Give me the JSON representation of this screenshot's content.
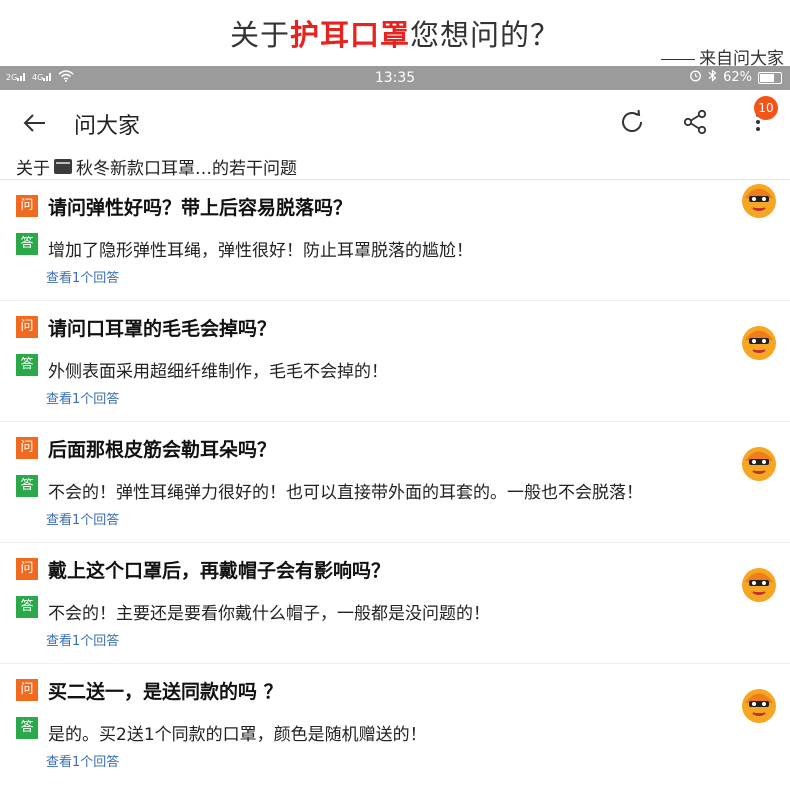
{
  "promo": {
    "title_before": "关于",
    "title_highlight": "护耳口罩",
    "title_after": "您想问的？",
    "source": "来自问大家"
  },
  "statusbar": {
    "signal_left": "2G",
    "signal_right": "4G",
    "time": "13:35",
    "battery": "62%",
    "battery_level": 0.62
  },
  "appbar": {
    "title": "问大家",
    "badge_count": "10",
    "icons": [
      "back-arrow-icon",
      "refresh-icon",
      "share-icon",
      "more-vertical-icon"
    ]
  },
  "about": {
    "prefix": "关于",
    "product": "秋冬新款口耳罩…的若干问题"
  },
  "labels": {
    "question_tag": "问",
    "answer_tag": "答"
  },
  "qa": [
    {
      "question": "请问弹性好吗？带上后容易脱落吗？",
      "answer": "增加了隐形弹性耳绳，弹性很好！防止耳罩脱落的尴尬！",
      "more": "查看1个回答"
    },
    {
      "question": "请问口耳罩的毛毛会掉吗？",
      "answer": "外侧表面采用超细纤维制作，毛毛不会掉的！",
      "more": "查看1个回答"
    },
    {
      "question": "后面那根皮筋会勒耳朵吗？",
      "answer": "不会的！弹性耳绳弹力很好的！也可以直接带外面的耳套的。一般也不会脱落！",
      "more": "查看1个回答"
    },
    {
      "question": "戴上这个口罩后，再戴帽子会有影响吗？",
      "answer": "不会的！主要还是要看你戴什么帽子，一般都是没问题的！",
      "more": "查看1个回答"
    },
    {
      "question": "买二送一，是送同款的吗 ？",
      "answer": "是的。买2送1个同款的口罩，颜色是随机赠送的！",
      "more": "查看1个回答"
    }
  ],
  "colors": {
    "question_tag": "#f06a1f",
    "answer_tag": "#2aa84a",
    "link": "#3a6fb0",
    "highlight": "#e8231f",
    "statusbar": "#9b9b9b"
  }
}
